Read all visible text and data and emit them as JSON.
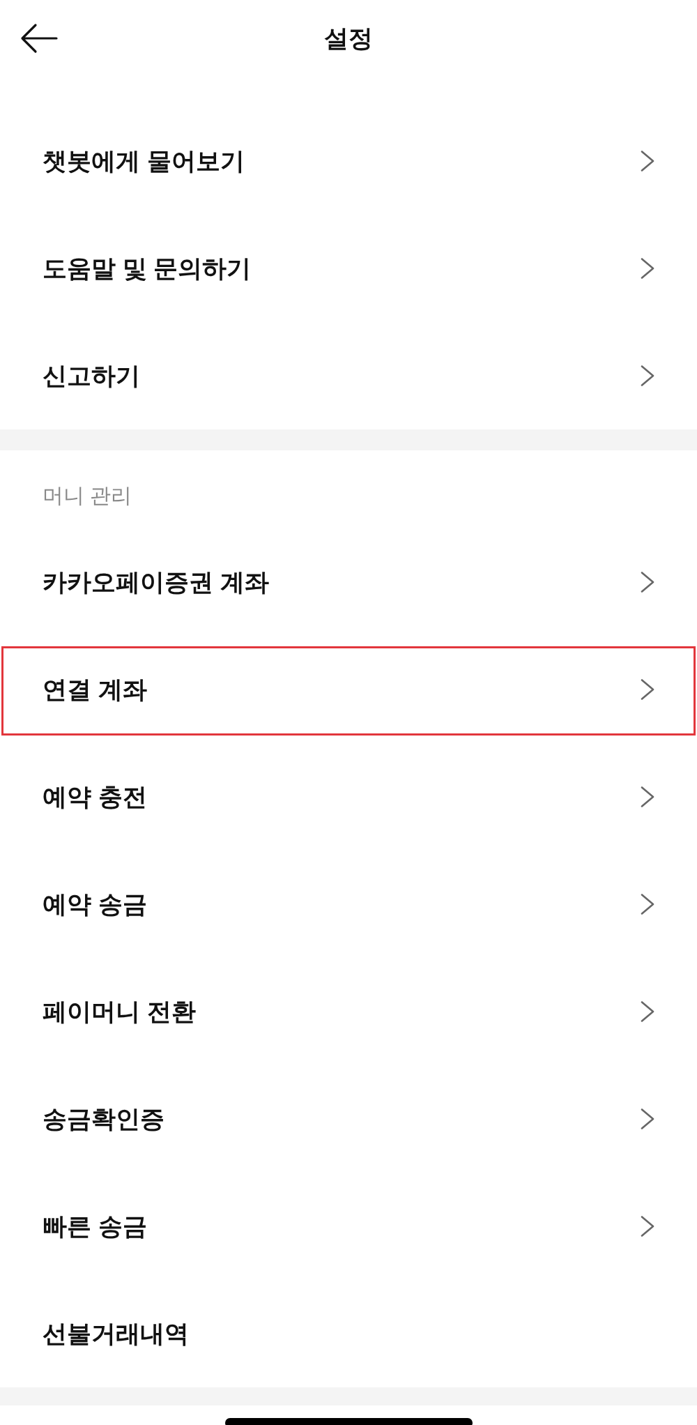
{
  "header": {
    "title": "설정"
  },
  "sections": [
    {
      "items": [
        {
          "label": "챗봇에게 물어보기",
          "chevron": true,
          "highlighted": false
        },
        {
          "label": "도움말 및 문의하기",
          "chevron": true,
          "highlighted": false
        },
        {
          "label": "신고하기",
          "chevron": true,
          "highlighted": false
        }
      ]
    },
    {
      "heading": "머니 관리",
      "items": [
        {
          "label": "카카오페이증권 계좌",
          "chevron": true,
          "highlighted": false
        },
        {
          "label": "연결 계좌",
          "chevron": true,
          "highlighted": true
        },
        {
          "label": "예약 충전",
          "chevron": true,
          "highlighted": false
        },
        {
          "label": "예약 송금",
          "chevron": true,
          "highlighted": false
        },
        {
          "label": "페이머니 전환",
          "chevron": true,
          "highlighted": false
        },
        {
          "label": "송금확인증",
          "chevron": true,
          "highlighted": false
        },
        {
          "label": "빠른 송금",
          "chevron": true,
          "highlighted": false
        },
        {
          "label": "선불거래내역",
          "chevron": false,
          "highlighted": false
        }
      ]
    }
  ]
}
